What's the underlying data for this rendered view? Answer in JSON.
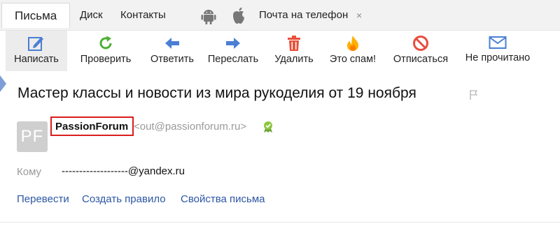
{
  "tabs": {
    "mail": "Письма",
    "disk": "Диск",
    "contacts": "Контакты",
    "phone": "Почта на телефон",
    "close": "×",
    "icons": [
      "android-icon",
      "apple-icon"
    ]
  },
  "toolbar": {
    "compose": "Написать",
    "check": "Проверить",
    "reply": "Ответить",
    "forward": "Переслать",
    "delete": "Удалить",
    "spam": "Это спам!",
    "unsubscribe": "Отписаться",
    "unread": "Не прочитано"
  },
  "message": {
    "subject": "Мастер классы и новости из мира рукоделия от 19 ноября",
    "avatar_initials": "PF",
    "sender_name": "PassionForum",
    "sender_email": "<out@passionforum.ru>",
    "to_label": "Кому",
    "to_value": "-------------------@yandex.ru"
  },
  "links": {
    "translate": "Перевести",
    "create_rule": "Создать правило",
    "properties": "Свойства письма"
  },
  "colors": {
    "accent_blue": "#4a7fd4",
    "refresh_green": "#4caf32",
    "delete_red": "#e8503a",
    "spam_orange": "#ffb000",
    "unsubscribe_red": "#e84c3d",
    "link_blue": "#2d57a3",
    "highlight_box": "#d81e1e"
  }
}
